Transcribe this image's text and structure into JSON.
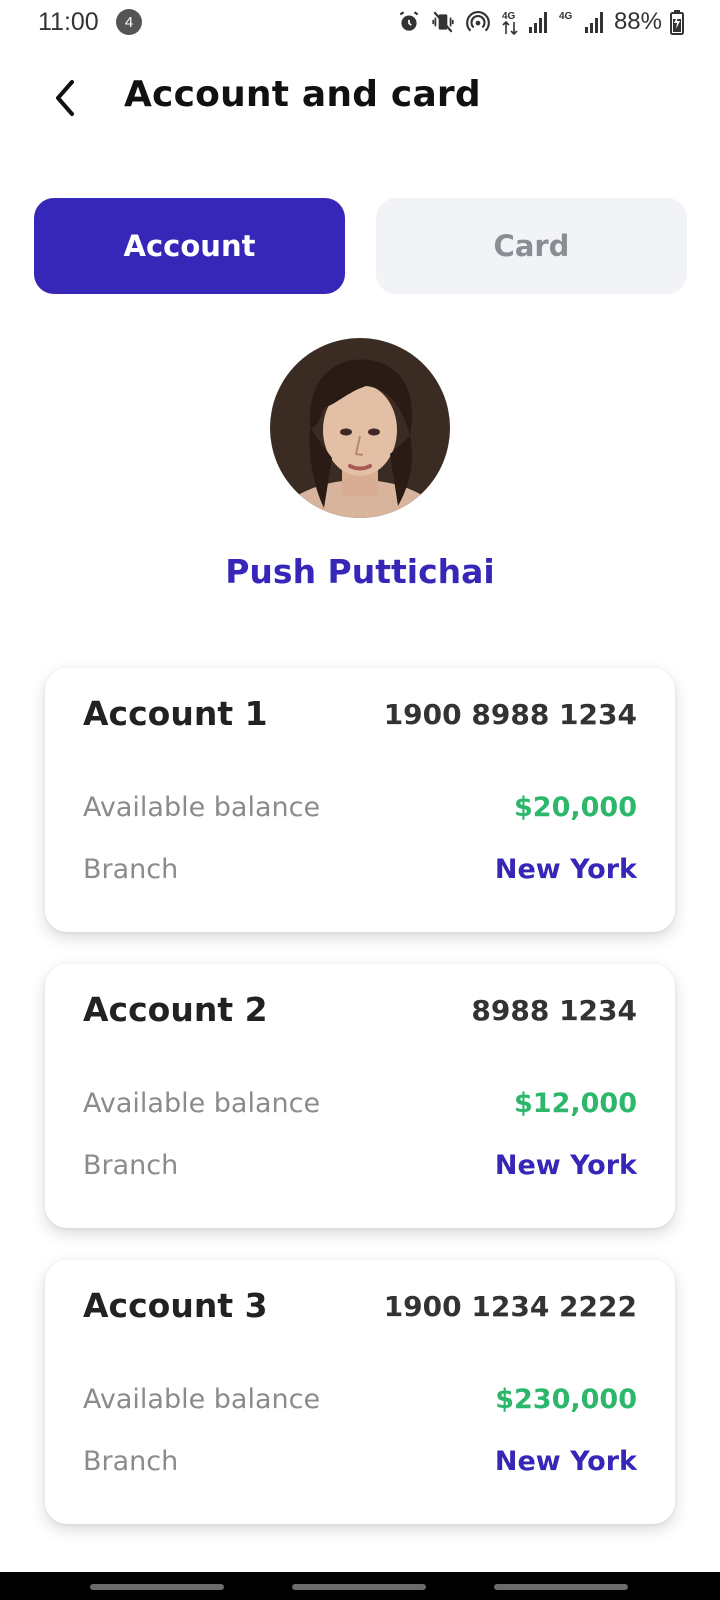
{
  "status_bar": {
    "time": "11:00",
    "notification_count": "4",
    "battery": "88%",
    "icons": [
      "alarm-icon",
      "vibrate-off-icon",
      "hotspot-icon",
      "4g-data-icon",
      "signal-icon",
      "4g-icon",
      "signal-icon",
      "battery-charging-icon"
    ]
  },
  "header": {
    "title": "Account and card",
    "back_icon": "chevron-left-icon"
  },
  "tabs": [
    {
      "label": "Account",
      "active": true
    },
    {
      "label": "Card",
      "active": false
    }
  ],
  "profile": {
    "name": "Push Puttichai"
  },
  "accounts": [
    {
      "name": "Account 1",
      "number": "1900 8988 1234",
      "balance_label": "Available balance",
      "balance": "$20,000",
      "branch_label": "Branch",
      "branch": "New York"
    },
    {
      "name": "Account 2",
      "number": "8988 1234",
      "balance_label": "Available balance",
      "balance": "$12,000",
      "branch_label": "Branch",
      "branch": "New York"
    },
    {
      "name": "Account 3",
      "number": "1900 1234 2222",
      "balance_label": "Available balance",
      "balance": "$230,000",
      "branch_label": "Branch",
      "branch": "New York"
    }
  ],
  "colors": {
    "primary": "#3727b8",
    "balance_green": "#2db76a",
    "tab_inactive_bg": "#f2f3f7",
    "tab_inactive_text": "#8a8d94"
  }
}
